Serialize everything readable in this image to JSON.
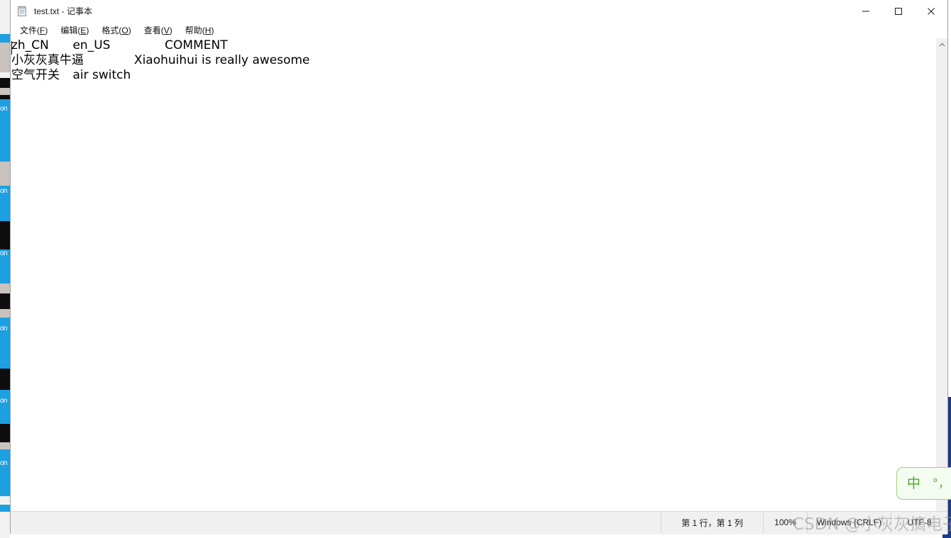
{
  "window": {
    "title": "test.txt - 记事本",
    "icon": "notepad-icon",
    "minimize_label": "–",
    "maximize_label": "□",
    "close_label": "✕"
  },
  "menubar": {
    "items": [
      {
        "label": "文件",
        "mnemonic": "F"
      },
      {
        "label": "编辑",
        "mnemonic": "E"
      },
      {
        "label": "格式",
        "mnemonic": "O"
      },
      {
        "label": "查看",
        "mnemonic": "V"
      },
      {
        "label": "帮助",
        "mnemonic": "H"
      }
    ]
  },
  "document": {
    "lines": [
      "zh_CN\ten_US\t\tCOMMENT",
      "小灰灰真牛逼\t\tXiaohuihui is really awesome",
      "空气开关\tair switch"
    ]
  },
  "statusbar": {
    "position": "第 1 行，第 1 列",
    "zoom": "100%",
    "line_ending": "Windows (CRLF)",
    "encoding": "UTF-8"
  },
  "watermark": {
    "text": "CSDN @小灰灰搞电子"
  },
  "ime": {
    "mode": "中",
    "punctuation": "°，",
    "soft_keyboard": "⬆"
  },
  "colors": {
    "accent_blue": "#1e9fe0",
    "desktop_blue": "#1b3a8c",
    "ime_green": "#4fa82e",
    "statusbar_bg": "#f0f0f0"
  }
}
